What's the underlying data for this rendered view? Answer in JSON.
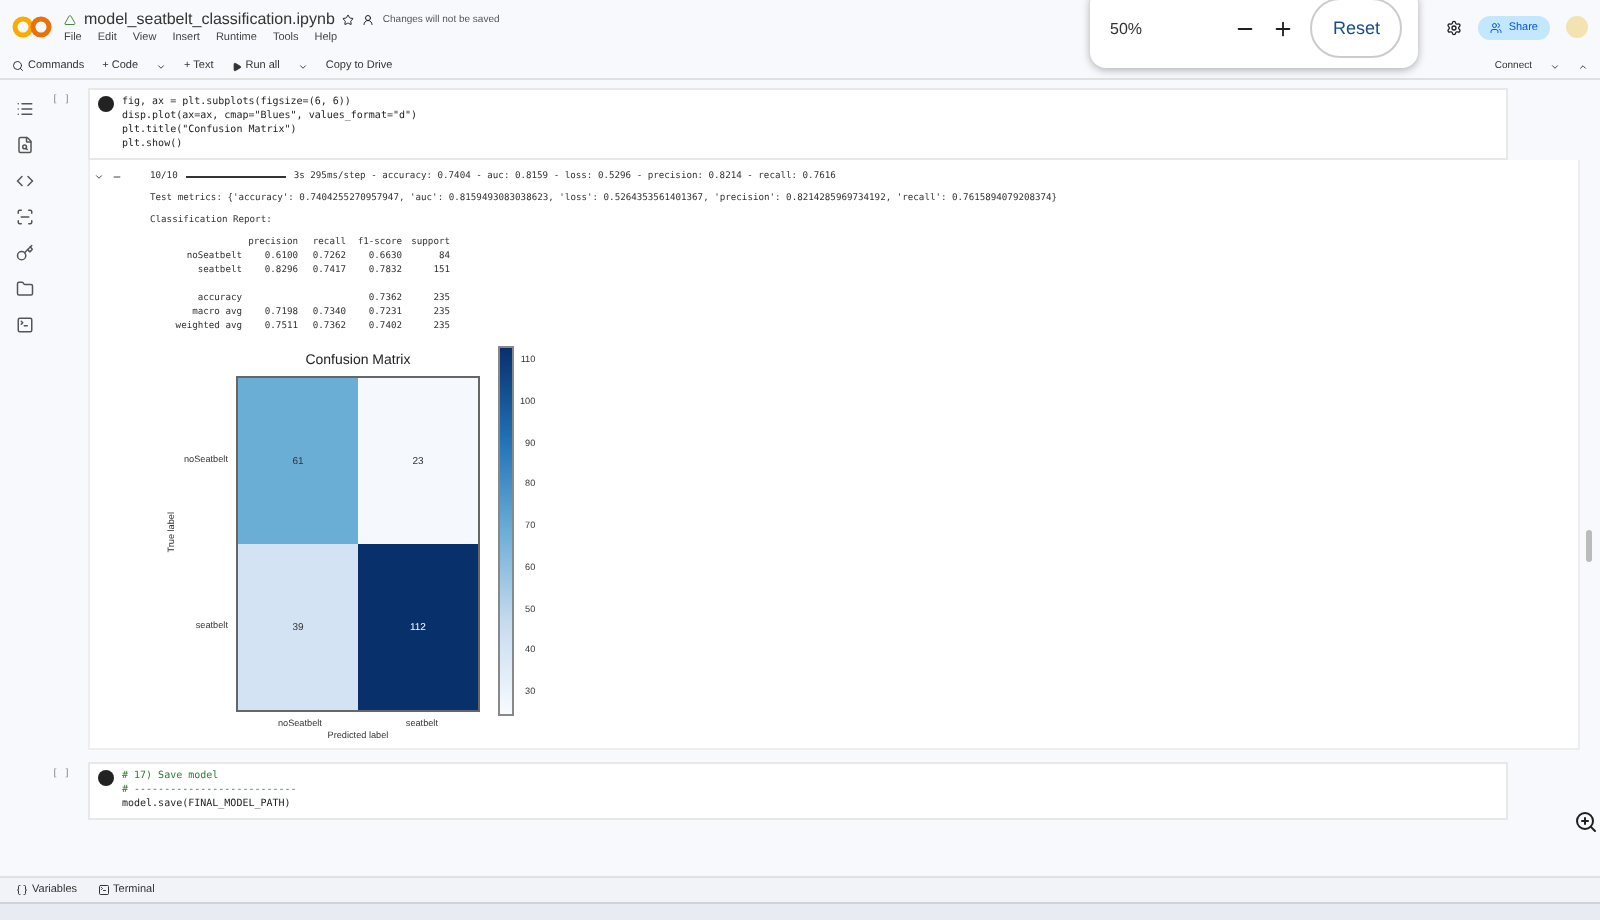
{
  "header": {
    "file_name": "model_seatbelt_classification.ipynb",
    "save_note": "Changes will not be saved",
    "menu": [
      "File",
      "Edit",
      "View",
      "Insert",
      "Runtime",
      "Tools",
      "Help"
    ],
    "share": "Share",
    "connect": "Connect"
  },
  "toolbar": {
    "commands": "Commands",
    "add_code": "+ Code",
    "add_text": "+ Text",
    "run_all": "Run all",
    "copy": "Copy to Drive"
  },
  "zoom_popup": {
    "value": "50%",
    "reset": "Reset"
  },
  "cells": [
    {
      "prompt": "[ ]",
      "lines": [
        {
          "kind": "code",
          "text": "fig, ax = plt.subplots(figsize=(6, 6))"
        },
        {
          "kind": "code",
          "text": "disp.plot(ax=ax, cmap=\"Blues\", values_format=\"d\")"
        },
        {
          "kind": "code",
          "text": "plt.title(\"Confusion Matrix\")"
        },
        {
          "kind": "code",
          "text": "plt.show()"
        }
      ],
      "output": {
        "progress": "10/10",
        "level": 1,
        "progress_text": "3s 295ms/step - accuracy: 0.7404 - auc: 0.8159 - loss: 0.5296 - precision: 0.8214 - recall: 0.7616",
        "metrics": "Test metrics: {'accuracy': 0.7404255270957947, 'auc': 0.8159493083038623, 'loss': 0.5264353561401367, 'precision': 0.8214285969734192, 'recall': 0.7615894079208374}",
        "report_title": "Classification Report:",
        "report_header": [
          "precision",
          "recall",
          "f1-score",
          "support"
        ],
        "report_rows": [
          [
            "noSeatbelt",
            "0.6100",
            "0.7262",
            "0.6630",
            "84"
          ],
          [
            "seatbelt",
            "0.8296",
            "0.7417",
            "0.7832",
            "151"
          ],
          [],
          [
            "accuracy",
            "",
            "",
            "0.7362",
            "235"
          ],
          [
            "macro avg",
            "0.7198",
            "0.7340",
            "0.7231",
            "235"
          ],
          [
            "weighted avg",
            "0.7511",
            "0.7362",
            "0.7402",
            "235"
          ]
        ],
        "matrix": {
          "title": "Confusion Matrix",
          "xlabel": "Predicted label",
          "ylabel": "True label",
          "row_labels": [
            "noSeatbelt",
            "seatbelt"
          ],
          "column_labels": [
            "noSeatbelt",
            "seatbelt"
          ],
          "cells": [
            {
              "text": "61",
              "color": "#6aaed6"
            },
            {
              "text": "23",
              "color": "#f5f9fe"
            },
            {
              "text": "39",
              "color": "#d3e3f3"
            },
            {
              "text": "112",
              "color": "#08306b"
            }
          ],
          "colorbar_ticks": [
            "110",
            "100",
            "90",
            "80",
            "70",
            "60",
            "50",
            "40",
            "30"
          ]
        }
      }
    },
    {
      "prompt": "[ ]",
      "lines": [
        {
          "kind": "comment",
          "text": "# 17) Save model"
        },
        {
          "kind": "comment",
          "text": "# ---------------------------"
        },
        {
          "kind": "code",
          "text": "model.save(FINAL_MODEL_PATH)"
        }
      ]
    }
  ],
  "status_bar": {
    "variables": "Variables",
    "terminal": "Terminal"
  }
}
